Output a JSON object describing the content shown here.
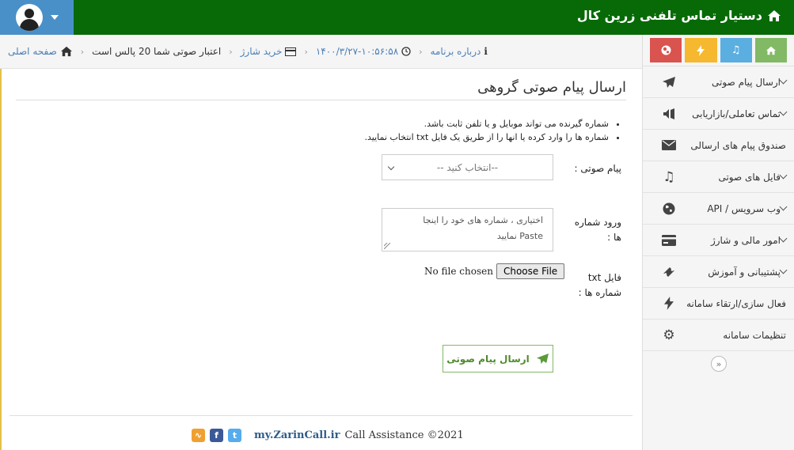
{
  "header": {
    "brand_title": "دستیار تماس تلفنی زرین کال"
  },
  "sidebar": {
    "items": [
      {
        "label": "ارسال پیام صوتی",
        "icon": "send-icon",
        "has_submenu": true
      },
      {
        "label": "تماس تعاملی/بازاریابی",
        "icon": "megaphone-icon",
        "has_submenu": true
      },
      {
        "label": "صندوق پیام های ارسالی",
        "icon": "envelope-icon",
        "has_submenu": false
      },
      {
        "label": "فایل های صوتی",
        "icon": "music-note-icon",
        "has_submenu": true
      },
      {
        "label": "وب سرویس / API",
        "icon": "globe-icon",
        "has_submenu": true
      },
      {
        "label": "امور مالی و شارژ",
        "icon": "credit-card-icon",
        "has_submenu": true
      },
      {
        "label": "پشتیبانی و آموزش",
        "icon": "ticket-icon",
        "has_submenu": true
      },
      {
        "label": "فعال سازی/ارتقاء سامانه",
        "icon": "bolt-icon",
        "has_submenu": false
      },
      {
        "label": "تنظیمات سامانه",
        "icon": "gear-icon",
        "has_submenu": false
      }
    ]
  },
  "breadcrumb": {
    "home": "صفحه اصلی",
    "credit": "اعتبار صوتی شما 20 پالس است",
    "buy_charge": "خرید شارژ",
    "datetime": "۱۴۰۰/۳/۲۷-۱۰:۵۶:۵۸",
    "about": "درباره برنامه"
  },
  "main": {
    "title": "ارسال پیام صوتی گروهی",
    "notes": [
      "شماره گیرنده می تواند موبایل و یا تلفن ثابت باشد.",
      "شماره ها را وارد کرده یا انها را از طریق یک فایل txt انتخاب نمایید."
    ],
    "voice_label": "پیام صوتی :",
    "voice_select_value": "--انتخاب کنید --",
    "numbers_label_1": "ورود شماره",
    "numbers_label_2": "ها :",
    "numbers_placeholder_1": "اختیاری ، شماره های خود را اینجا",
    "numbers_placeholder_2": "Paste نمایید",
    "file_label_1": "فایل txt",
    "file_label_2": "شماره ها :",
    "file_button": "Choose File",
    "file_status": "No file chosen",
    "submit_label": "ارسال پیام صوتی"
  },
  "footer": {
    "copyright": "Call Assistance ©2021",
    "site": "my.ZarinCall.ir"
  },
  "colors": {
    "topbar": "#076a07",
    "user_box": "#4a90c8",
    "accent_green": "#82b964",
    "link_blue": "#4a7fb8"
  }
}
